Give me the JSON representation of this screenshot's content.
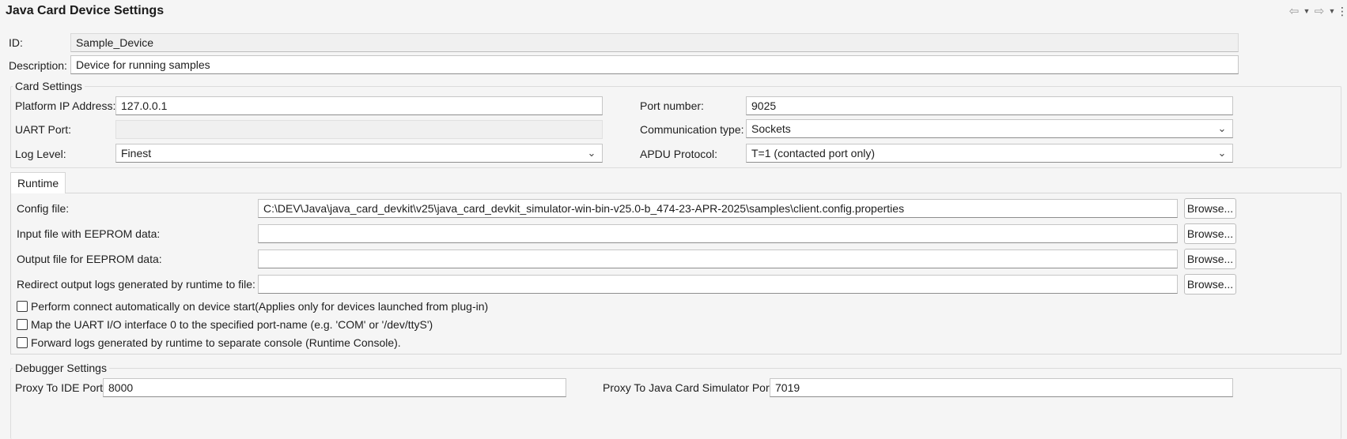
{
  "header": {
    "title": "Java Card Device Settings",
    "toolbar": {
      "back_icon": "back-arrow-icon",
      "forward_icon": "forward-arrow-icon",
      "dropdown_icon": "chevron-down-icon",
      "menu_icon": "vertical-dots-icon"
    }
  },
  "device": {
    "id_label": "ID:",
    "id_value": "Sample_Device",
    "description_label": "Description:",
    "description_value": "Device for running samples"
  },
  "card_settings": {
    "title": "Card Settings",
    "platform_ip_label": "Platform IP Address:",
    "platform_ip_value": "127.0.0.1",
    "uart_port_label": "UART Port:",
    "uart_port_value": "",
    "log_level_label": "Log Level:",
    "log_level_value": "Finest",
    "port_number_label": "Port number:",
    "port_number_value": "9025",
    "communication_type_label": "Communication type:",
    "communication_type_value": "Sockets",
    "apdu_protocol_label": "APDU Protocol:",
    "apdu_protocol_value": "T=1 (contacted port only)"
  },
  "runtime": {
    "tab_label": "Runtime",
    "config_file_label": "Config file:",
    "config_file_value": "C:\\DEV\\Java\\java_card_devkit\\v25\\java_card_devkit_simulator-win-bin-v25.0-b_474-23-APR-2025\\samples\\client.config.properties",
    "input_eeprom_label": "Input file with EEPROM data:",
    "input_eeprom_value": "",
    "output_eeprom_label": "Output file for EEPROM data:",
    "output_eeprom_value": "",
    "redirect_logs_label": "Redirect output logs generated by runtime to file:",
    "redirect_logs_value": "",
    "browse_label": "Browse...",
    "checkboxes": [
      {
        "label": "Perform connect automatically on device start(Applies only for devices launched from plug-in)",
        "checked": false
      },
      {
        "label": "Map the UART I/O interface 0 to the specified port-name (e.g. 'COM' or '/dev/ttyS')",
        "checked": false
      },
      {
        "label": "Forward logs generated by runtime to separate console (Runtime Console).",
        "checked": false
      }
    ]
  },
  "debugger_settings": {
    "title": "Debugger Settings",
    "proxy_ide_label": "Proxy To IDE Port:",
    "proxy_ide_value": "8000",
    "proxy_simulator_label": "Proxy To Java Card Simulator Port:",
    "proxy_simulator_value": "7019"
  },
  "colors": {
    "background": "#f5f5f5",
    "field_background": "#ffffff",
    "readonly_background": "#f0f0f0",
    "border": "#c6c6c6"
  }
}
